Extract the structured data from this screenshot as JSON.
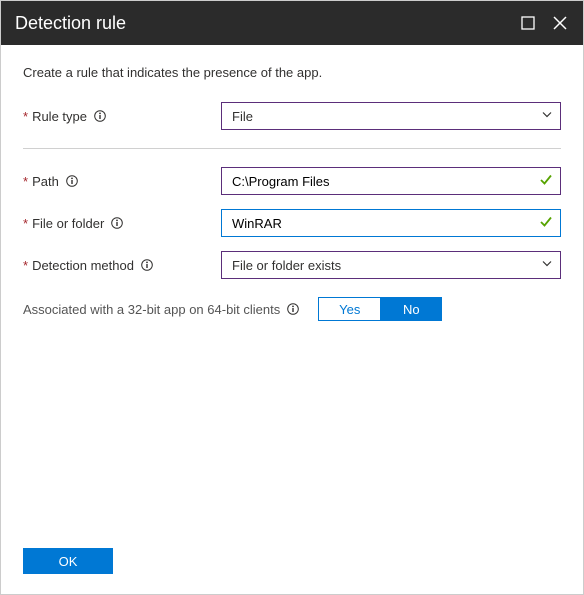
{
  "header": {
    "title": "Detection rule"
  },
  "description": "Create a rule that indicates the presence of the app.",
  "fields": {
    "ruleType": {
      "label": "Rule type",
      "value": "File"
    },
    "path": {
      "label": "Path",
      "value": "C:\\Program Files"
    },
    "fileOrFolder": {
      "label": "File or folder",
      "value": "WinRAR"
    },
    "detectionMethod": {
      "label": "Detection method",
      "value": "File or folder exists"
    }
  },
  "toggle": {
    "label": "Associated with a 32-bit app on 64-bit clients",
    "yes": "Yes",
    "no": "No"
  },
  "footer": {
    "ok": "OK"
  }
}
